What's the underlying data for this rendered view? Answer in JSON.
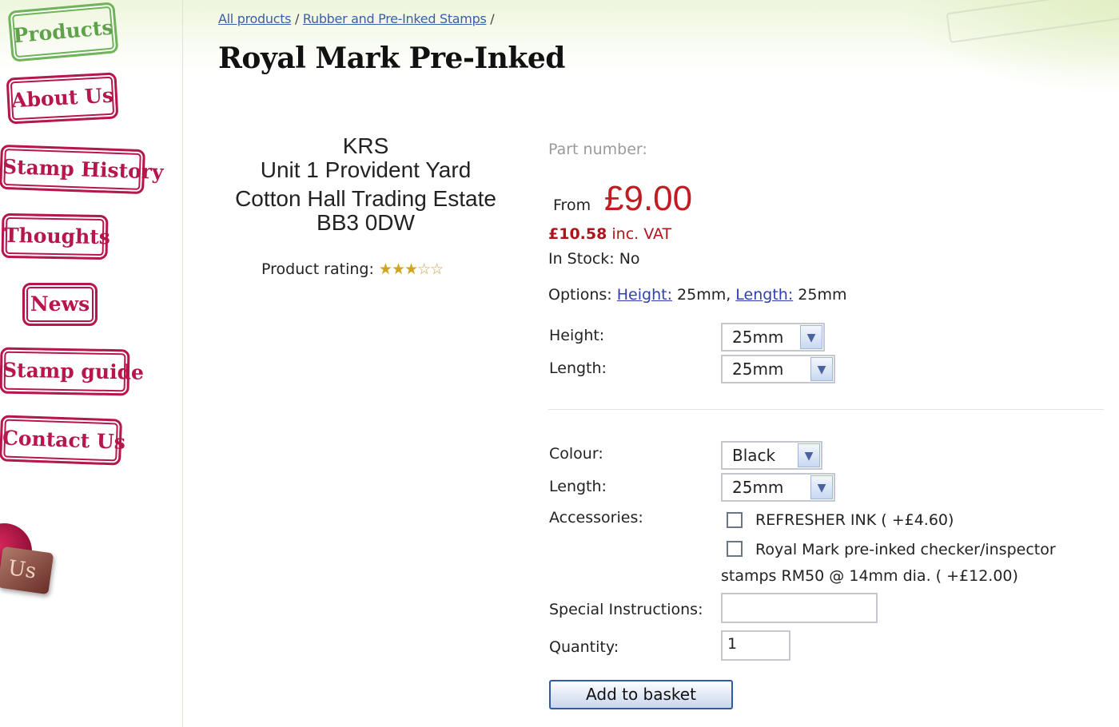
{
  "nav": {
    "products": "Products",
    "about": "About Us",
    "history": "Stamp History",
    "thoughts": "Thoughts",
    "news": "News",
    "guide": "Stamp guide",
    "contact": "Contact Us",
    "tag": "Us"
  },
  "breadcrumb": {
    "all_products": "All products",
    "sep1": " / ",
    "category": "Rubber and Pre-Inked Stamps",
    "sep2": " /"
  },
  "product": {
    "title": "Royal Mark Pre-Inked",
    "address": [
      "KRS",
      "Unit 1 Provident Yard",
      "Cotton Hall Trading Estate",
      "BB3  0DW"
    ],
    "rating_label": "Product rating:",
    "rating": 3,
    "rating_max": 5,
    "part_number_label": "Part number:",
    "from_label": "From",
    "price": "£9.00",
    "vat_price": "£10.58",
    "vat_label": " inc. VAT",
    "stock": "In Stock: No",
    "options": {
      "label": "Options: ",
      "height_link": "Height:",
      "height_value": " 25mm, ",
      "length_link": "Length:",
      "length_value": " 25mm"
    }
  },
  "form": {
    "height_label": "Height:",
    "height_value": "25mm",
    "length_label": "Length:",
    "length_value": "25mm",
    "colour_label": "Colour:",
    "colour_value": "Black",
    "length2_label": "Length:",
    "length2_value": "25mm",
    "accessories_label": "Accessories:",
    "accessory1": "REFRESHER INK ( +£4.60)",
    "accessory2_line1": "Royal Mark pre-inked checker/inspector",
    "accessory2_line2": "stamps RM50 @ 14mm dia. ( +£12.00)",
    "special_label": "Special Instructions:",
    "special_value": "",
    "quantity_label": "Quantity:",
    "quantity_value": "1",
    "add_button": "Add to basket"
  },
  "icons": {
    "dropdown": "chevron-down-icon",
    "star_full": "★",
    "star_empty": "☆"
  }
}
